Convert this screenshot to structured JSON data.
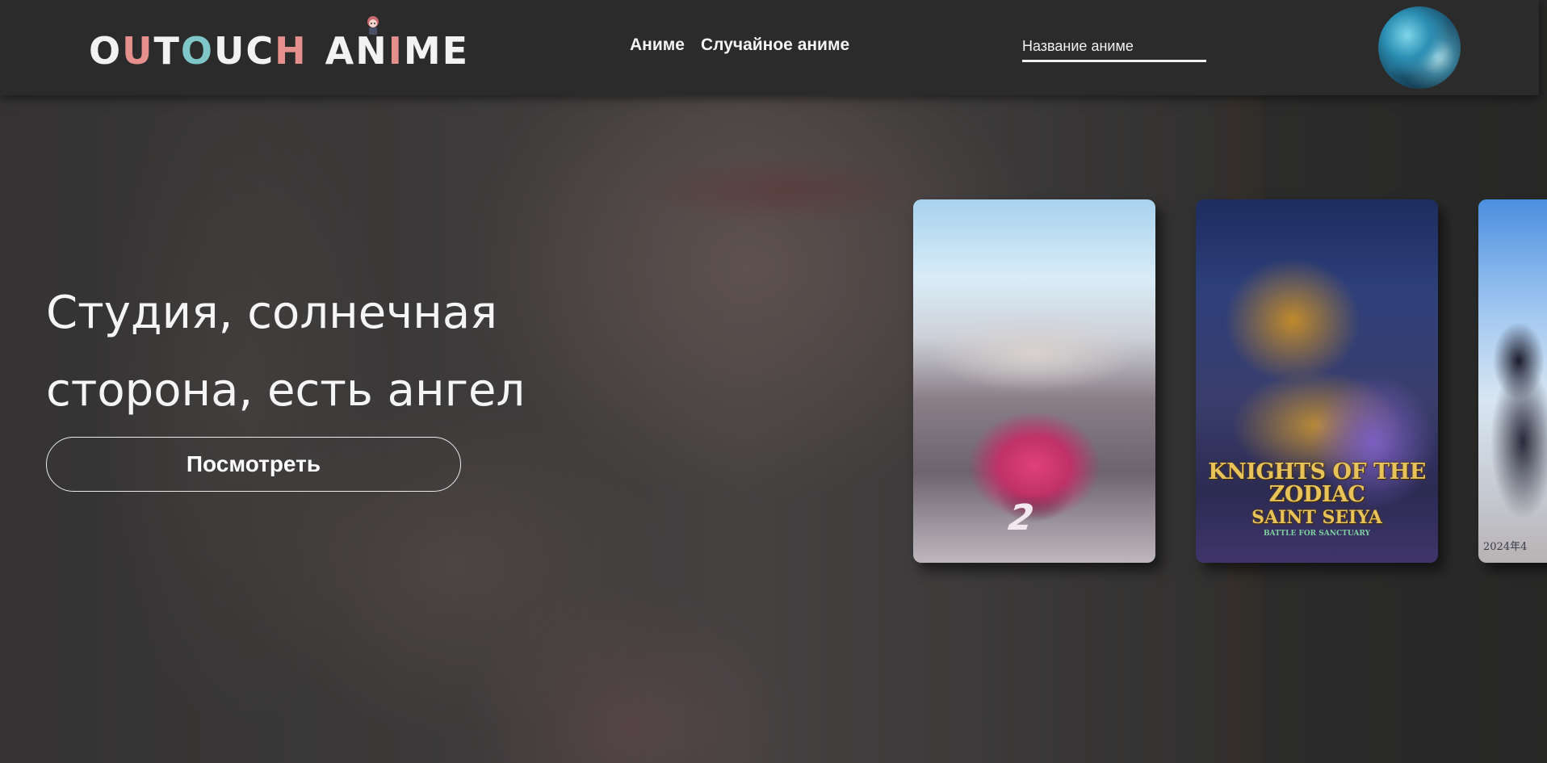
{
  "header": {
    "logo_text": "OUTOUCH ANIME",
    "nav": [
      {
        "label": "Аниме"
      },
      {
        "label": "Случайное аниме"
      }
    ],
    "search": {
      "placeholder": "Название аниме",
      "value": ""
    },
    "avatar_icon": "user-avatar"
  },
  "hero": {
    "title": "Студия, солнечная сторона, есть ангел",
    "watch_label": "Посмотреть"
  },
  "posters": [
    {
      "icon": "poster-racing-anime",
      "overlay_text": "2"
    },
    {
      "icon": "poster-saint-seiya",
      "logo_line1": "KNIGHTS OF THE ZODIAC",
      "logo_line2": "SAINT SEIYA",
      "logo_line3": "BATTLE FOR SANCTUARY"
    },
    {
      "icon": "poster-school-anime",
      "overlay_text": "2024年4"
    }
  ],
  "colors": {
    "header_bg": "#2c2b2b",
    "logo_accent_pink": "#e6908e",
    "logo_accent_teal": "#7ec6c7",
    "text": "#f5f5f5"
  }
}
